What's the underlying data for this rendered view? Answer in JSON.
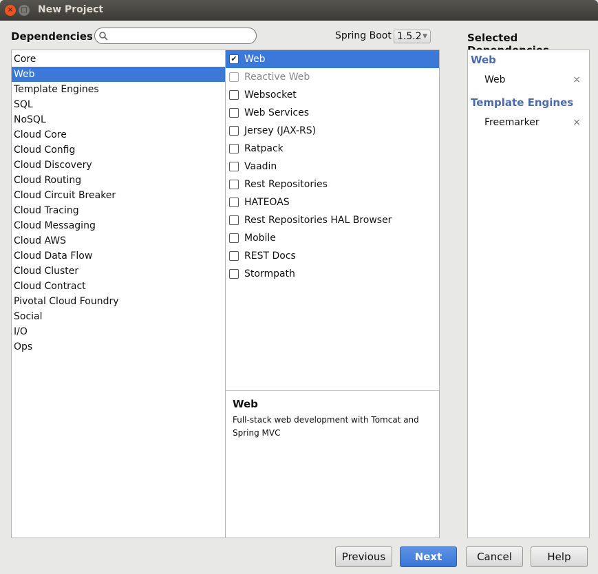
{
  "window": {
    "title": "New Project",
    "close_glyph": "×",
    "min_glyph": "□"
  },
  "header": {
    "dependencies_label": "Dependencies",
    "search_placeholder": "",
    "spring_boot_label": "Spring Boot",
    "spring_boot_version": "1.5.2"
  },
  "categories": [
    "Core",
    "Web",
    "Template Engines",
    "SQL",
    "NoSQL",
    "Cloud Core",
    "Cloud Config",
    "Cloud Discovery",
    "Cloud Routing",
    "Cloud Circuit Breaker",
    "Cloud Tracing",
    "Cloud Messaging",
    "Cloud AWS",
    "Cloud Data Flow",
    "Cloud Cluster",
    "Cloud Contract",
    "Pivotal Cloud Foundry",
    "Social",
    "I/O",
    "Ops"
  ],
  "selected_category": "Web",
  "dependencies": [
    {
      "label": "Web",
      "checked": true,
      "enabled": true
    },
    {
      "label": "Reactive Web",
      "checked": false,
      "enabled": false
    },
    {
      "label": "Websocket",
      "checked": false,
      "enabled": true
    },
    {
      "label": "Web Services",
      "checked": false,
      "enabled": true
    },
    {
      "label": "Jersey (JAX-RS)",
      "checked": false,
      "enabled": true
    },
    {
      "label": "Ratpack",
      "checked": false,
      "enabled": true
    },
    {
      "label": "Vaadin",
      "checked": false,
      "enabled": true
    },
    {
      "label": "Rest Repositories",
      "checked": false,
      "enabled": true
    },
    {
      "label": "HATEOAS",
      "checked": false,
      "enabled": true
    },
    {
      "label": "Rest Repositories HAL Browser",
      "checked": false,
      "enabled": true
    },
    {
      "label": "Mobile",
      "checked": false,
      "enabled": true
    },
    {
      "label": "REST Docs",
      "checked": false,
      "enabled": true
    },
    {
      "label": "Stormpath",
      "checked": false,
      "enabled": true
    }
  ],
  "description": {
    "title": "Web",
    "text": "Full-stack web development with Tomcat and Spring MVC"
  },
  "selected": {
    "title": "Selected Dependencies",
    "groups": [
      {
        "name": "Web",
        "items": [
          "Web"
        ]
      },
      {
        "name": "Template Engines",
        "items": [
          "Freemarker"
        ]
      }
    ],
    "remove_glyph": "×"
  },
  "buttons": {
    "previous": "Previous",
    "next": "Next",
    "cancel": "Cancel",
    "help": "Help"
  },
  "colors": {
    "accent": "#3b78d8",
    "group": "#4b6aa8"
  }
}
